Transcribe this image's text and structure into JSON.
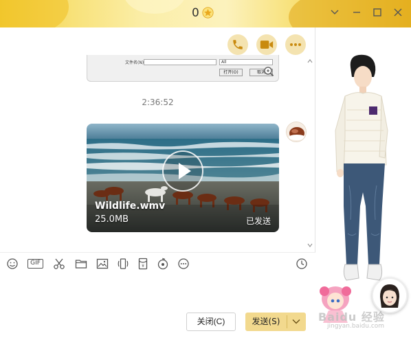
{
  "titlebar": {
    "count": "0",
    "icons": [
      "star-icon",
      "chevron-down-icon",
      "minimize-icon",
      "maximize-icon",
      "close-icon"
    ]
  },
  "chat_header_actions": [
    {
      "name": "phone-call-icon"
    },
    {
      "name": "video-call-icon"
    },
    {
      "name": "more-icon"
    }
  ],
  "file_dialog_thumbnail": {
    "filename_label": "文件名(N):",
    "filter_value": "All",
    "open_button": "打开(O)",
    "cancel_button": "取消"
  },
  "messages": {
    "timestamp": "2:36:52",
    "video": {
      "name": "Wildlife.wmv",
      "size": "25.0MB",
      "status": "已发送"
    }
  },
  "toolbar": {
    "gif_label": "GIF",
    "icons": [
      "emoji-icon",
      "gif-icon",
      "scissors-icon",
      "folder-icon",
      "image-icon",
      "phone-shake-icon",
      "red-packet-icon",
      "music-icon",
      "more-icon",
      "history-clock-icon"
    ]
  },
  "buttons": {
    "close_label": "关闭(C)",
    "send_label": "发送(S)"
  },
  "watermark": {
    "brand": "Baidu 经验",
    "url": "jingyan.baidu.com"
  },
  "colors": {
    "title_accent": "#f2cf3a",
    "action_button_bg": "#f4e3b0",
    "send_button_bg": "#f2d98e",
    "icon_color": "#d49b1c"
  }
}
